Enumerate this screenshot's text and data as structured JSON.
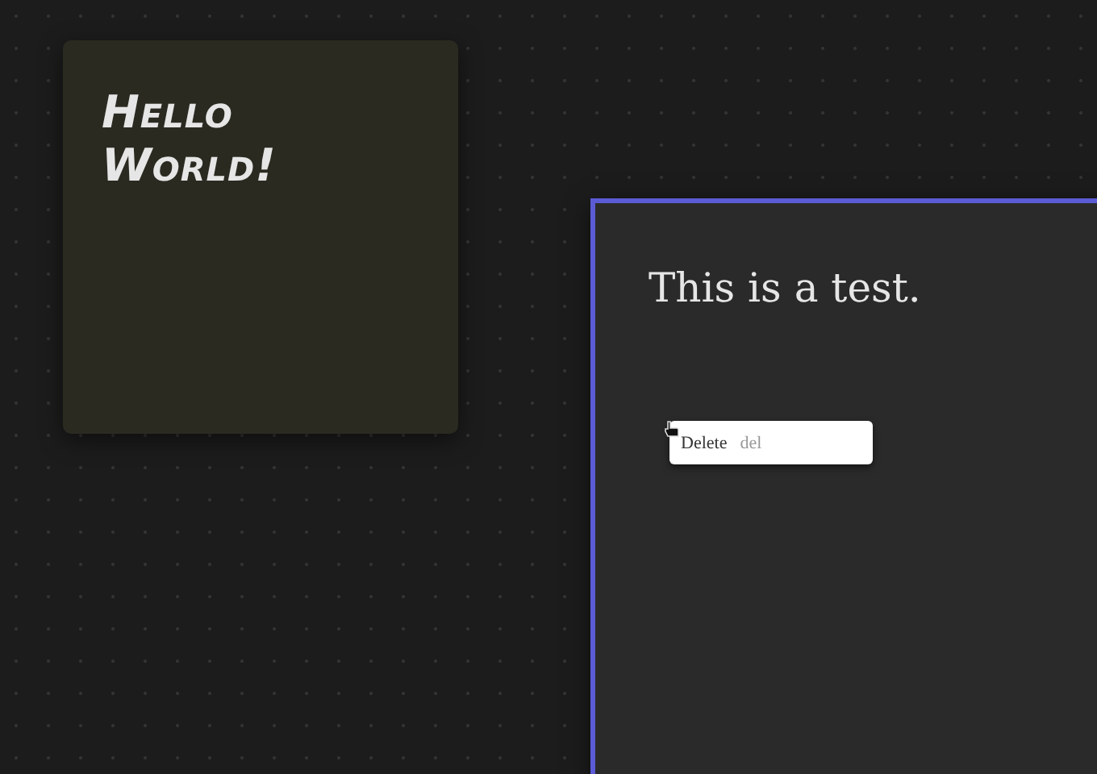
{
  "notes": [
    {
      "text": "Hello World!",
      "kind": "handwritten",
      "selected": false
    },
    {
      "text": "This is a test.",
      "kind": "serif",
      "selected": true
    }
  ],
  "context_menu": {
    "items": [
      {
        "label": "Delete",
        "shortcut": "del"
      }
    ]
  }
}
